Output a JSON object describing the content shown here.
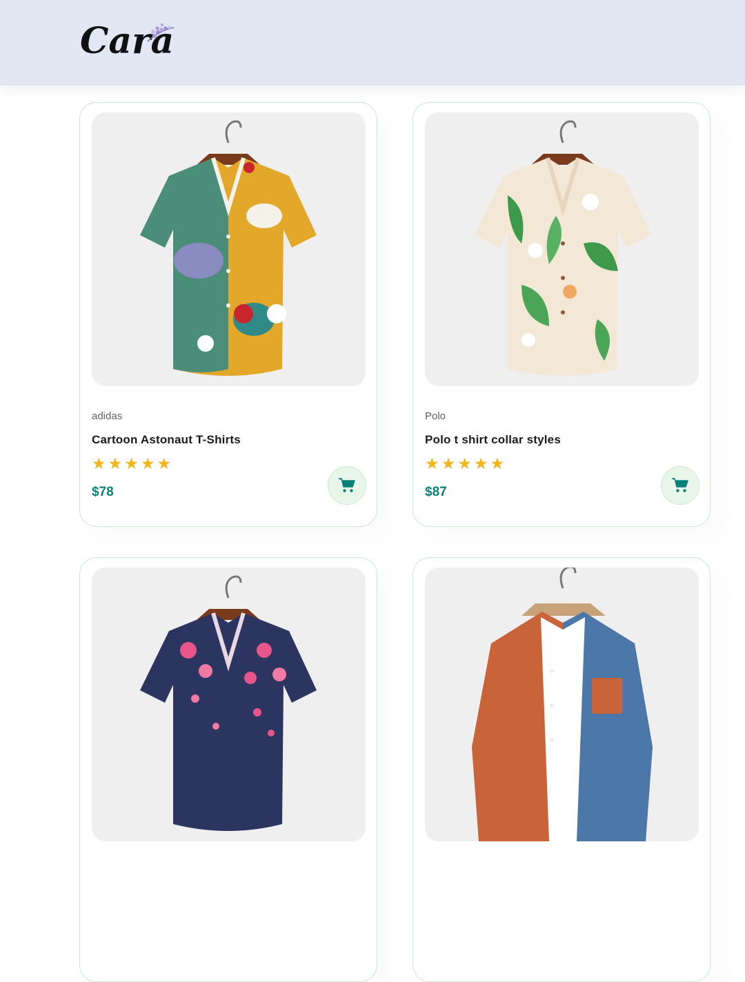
{
  "header": {
    "logo_text": "Cara",
    "background": "#e3e6f3"
  },
  "colors": {
    "accent": "#088178",
    "star": "#f3b519",
    "card_border": "#cce7d0",
    "cart_bg": "#e8f6ea"
  },
  "products": [
    {
      "brand": "adidas",
      "title": "Cartoon Astonaut T-Shirts",
      "rating": 5,
      "price": "$78",
      "image": "multicolor-print-shirt-on-hanger",
      "cart_icon": "cart-icon"
    },
    {
      "brand": "Polo",
      "title": "Polo t shirt collar styles",
      "rating": 5,
      "price": "$87",
      "image": "floral-leaf-print-shirt-on-hanger",
      "cart_icon": "cart-icon"
    },
    {
      "image": "navy-floral-shirt-on-hanger"
    },
    {
      "image": "orange-blue-corduroy-shirt-on-hanger"
    }
  ]
}
